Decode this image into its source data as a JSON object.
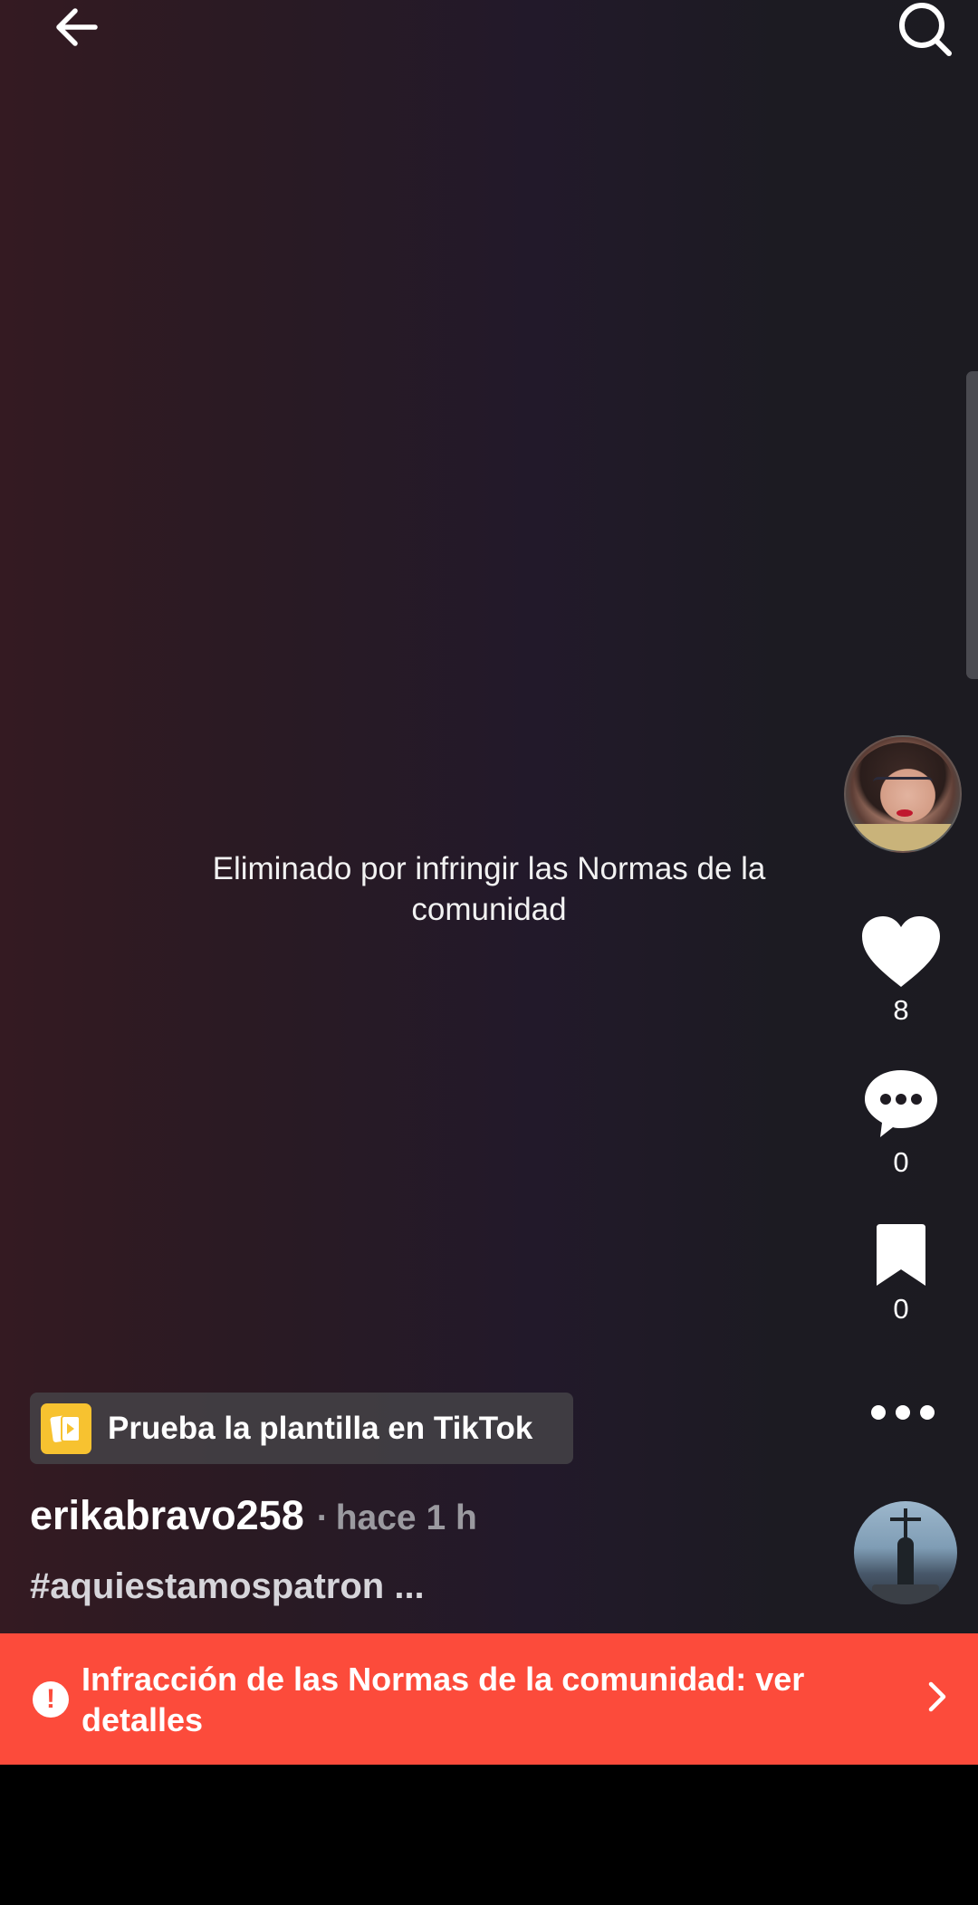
{
  "topbar": {
    "back_icon": "arrow-left-icon",
    "search_icon": "search-icon"
  },
  "video": {
    "removed_message": "Eliminado por infringir las Normas de la comunidad"
  },
  "actions": {
    "likes": "8",
    "comments": "0",
    "saves": "0"
  },
  "template": {
    "label": "Prueba la plantilla en TikTok"
  },
  "post": {
    "username": "erikabravo258",
    "separator": "·",
    "time_ago": "hace 1 h",
    "caption": "#aquiestamospatron ..."
  },
  "violation_banner": {
    "text": "Infracción de las Normas de la comunidad: ver detalles",
    "color": "#fc4b3b"
  }
}
